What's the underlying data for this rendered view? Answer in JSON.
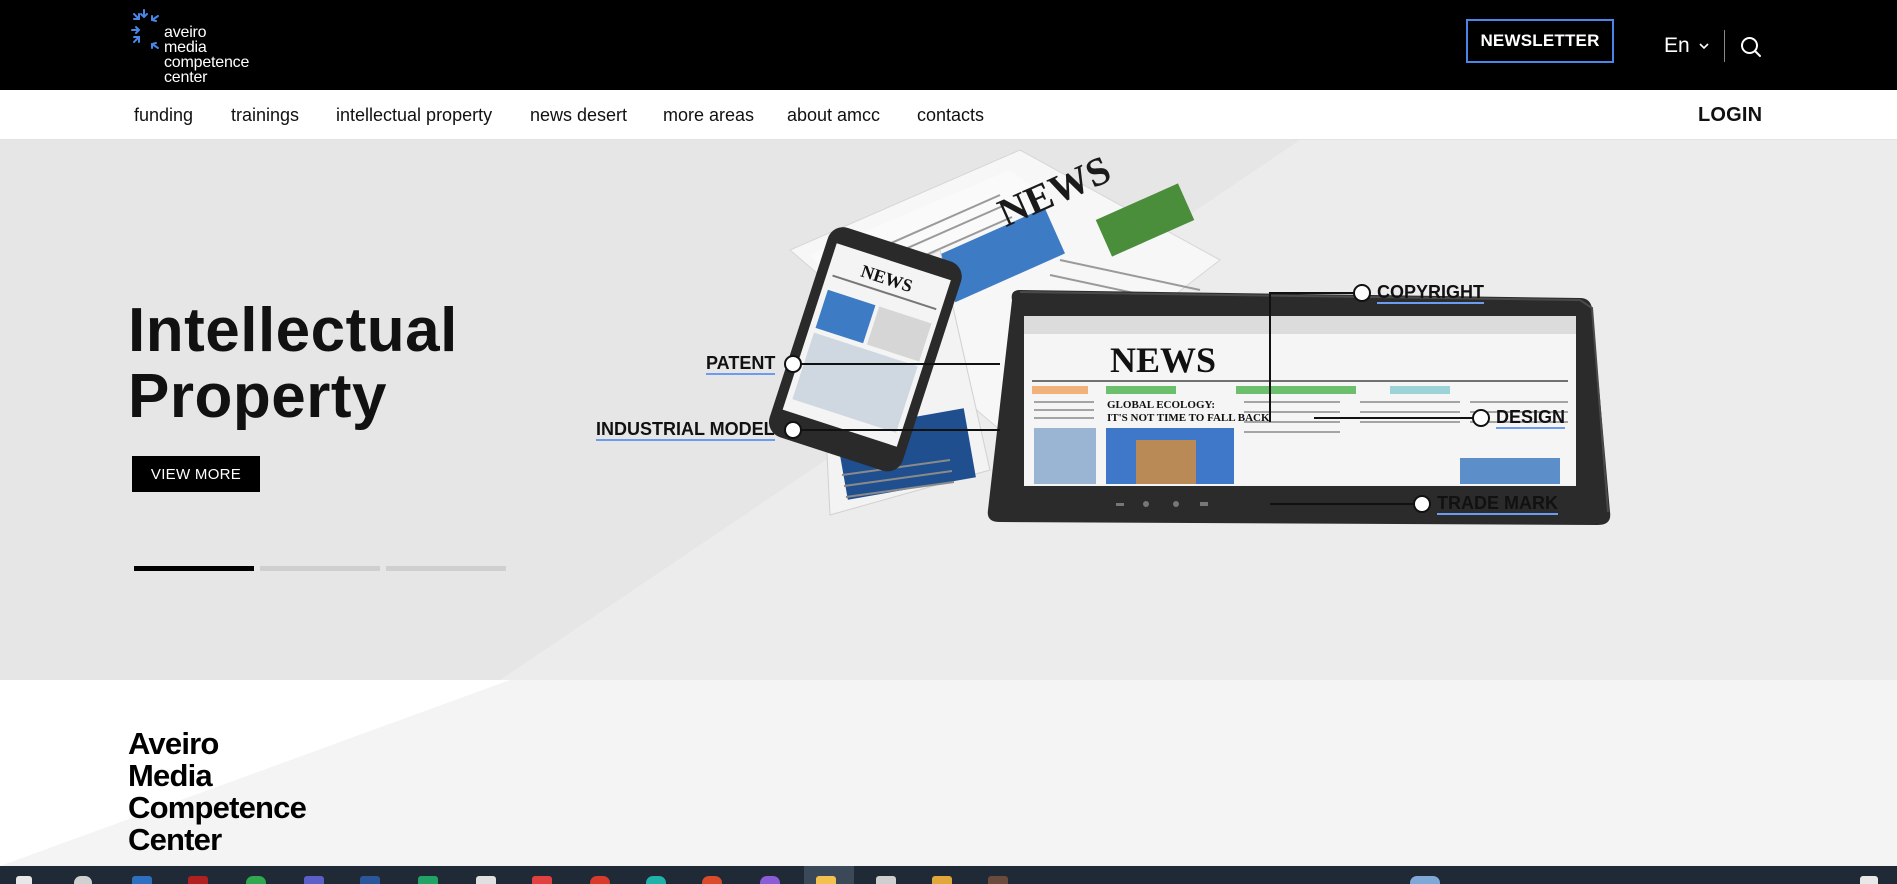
{
  "header": {
    "logo": {
      "lines": [
        "aveiro",
        "media",
        "competence",
        "center"
      ],
      "icon": "arrows-converging-icon"
    },
    "newsletter_label": "NEWSLETTER",
    "language": "En",
    "search_icon": "search-icon"
  },
  "nav": {
    "items": [
      "funding",
      "trainings",
      "intellectual property",
      "news desert",
      "more areas",
      "about amcc",
      "contacts"
    ],
    "login_label": "LOGIN"
  },
  "hero": {
    "title_lines": [
      "Intellectual",
      "Property"
    ],
    "button_label": "VIEW MORE",
    "slides": {
      "count": 3,
      "active_index": 0
    },
    "callouts": [
      "PATENT",
      "INDUSTRIAL MODEL",
      "COPYRIGHT",
      "DESIGN",
      "TRADE MARK"
    ],
    "illustration": {
      "tablet_headline": "NEWS",
      "tablet_subhead": [
        "GLOBAL ECOLOGY:",
        "IT'S NOT TIME TO FALL BACK"
      ],
      "phone_headline": "NEWS",
      "paper_headline": "NEWS"
    }
  },
  "about": {
    "title_lines": [
      "Aveiro",
      "Media",
      "Competence",
      "Center"
    ]
  },
  "colors": {
    "accent": "#4a86e8",
    "header_bg": "#000000",
    "hero_bg": "#e6e6e6",
    "taskbar_bg": "#1f2a36"
  }
}
